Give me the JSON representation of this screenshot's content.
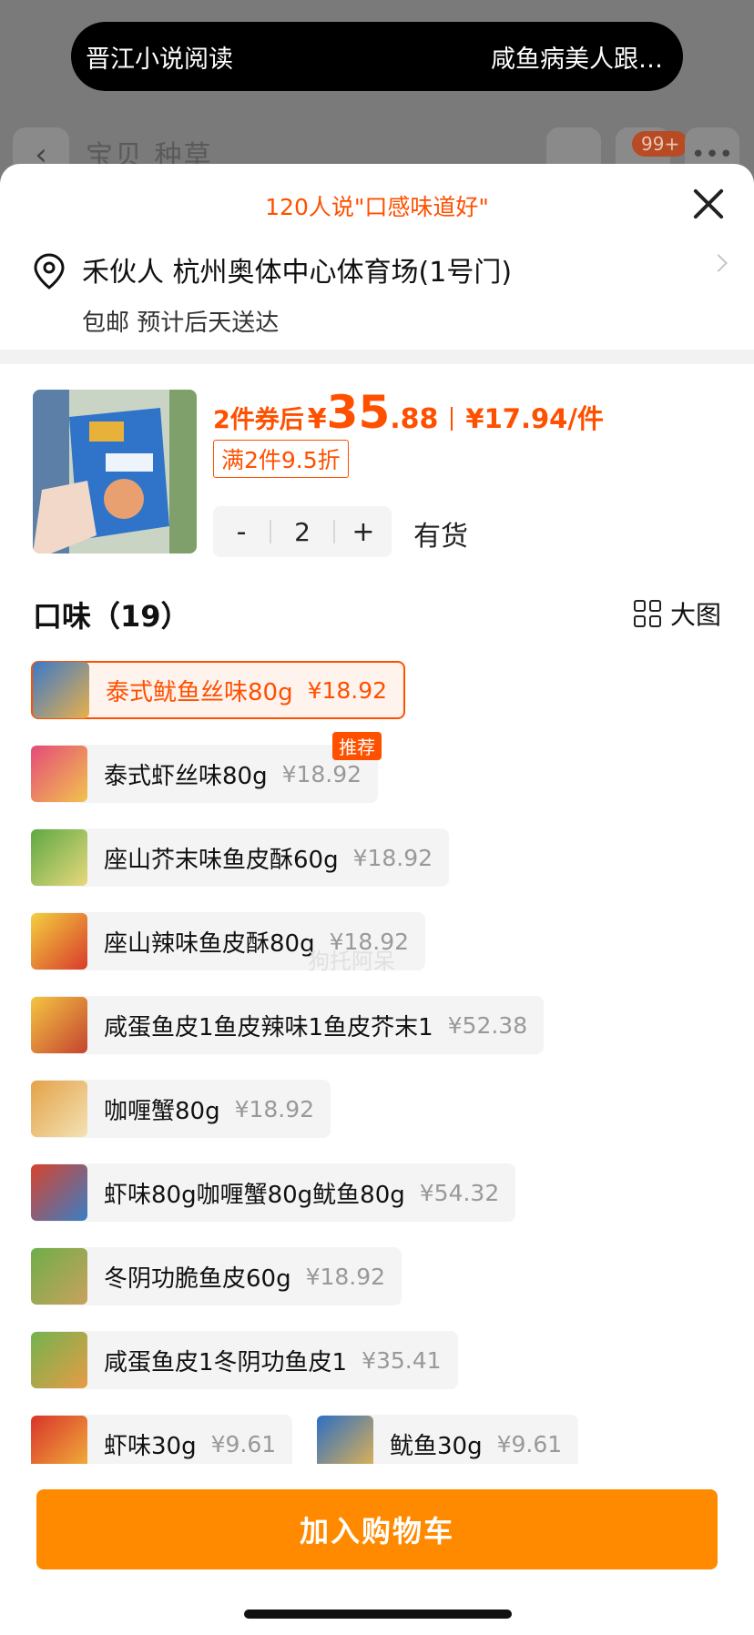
{
  "status_pill": {
    "left_text": "晋江小说阅读",
    "right_text": "咸鱼病美人跟…"
  },
  "background_nav": {
    "tabs": "宝贝 种草",
    "cart_badge": "99+"
  },
  "sheet": {
    "review_banner": "120人说\"口感味道好\"",
    "address": {
      "line": "禾伙人 杭州奥体中心体育场(1号门)",
      "delivery": "包邮 预计后天送达"
    },
    "product": {
      "price_prefix": "2件券后",
      "currency": "¥",
      "price_int": "35",
      "price_dec": ".88",
      "unit_price": "¥17.94/件",
      "discount_tag": "满2件9.5折",
      "quantity": "2",
      "minus": "-",
      "plus": "+",
      "stock": "有货"
    },
    "flavor_title": "口味（19）",
    "big_image_label": "大图",
    "options": [
      {
        "name": "泰式鱿鱼丝味80g",
        "price": "¥18.92",
        "selected": true
      },
      {
        "name": "泰式虾丝味80g",
        "price": "¥18.92",
        "tag": "推荐"
      },
      {
        "name": "座山芥末味鱼皮酥60g",
        "price": "¥18.92"
      },
      {
        "name": "座山辣味鱼皮酥80g",
        "price": "¥18.92"
      },
      {
        "name": "咸蛋鱼皮1鱼皮辣味1鱼皮芥末1",
        "price": "¥52.38"
      },
      {
        "name": "咖喱蟹80g",
        "price": "¥18.92"
      },
      {
        "name": "虾味80g咖喱蟹80g鱿鱼80g",
        "price": "¥54.32"
      },
      {
        "name": "冬阴功脆鱼皮60g",
        "price": "¥18.92"
      },
      {
        "name": "咸蛋鱼皮1冬阴功鱼皮1",
        "price": "¥35.41"
      },
      {
        "name": "虾味30g",
        "price": "¥9.61"
      },
      {
        "name": "鱿鱼30g",
        "price": "¥9.61"
      }
    ],
    "watermark": "狗托阿呆",
    "add_to_cart": "加入购物车"
  },
  "colors": {
    "accent": "#ff5000",
    "button": "#ff8a00"
  }
}
